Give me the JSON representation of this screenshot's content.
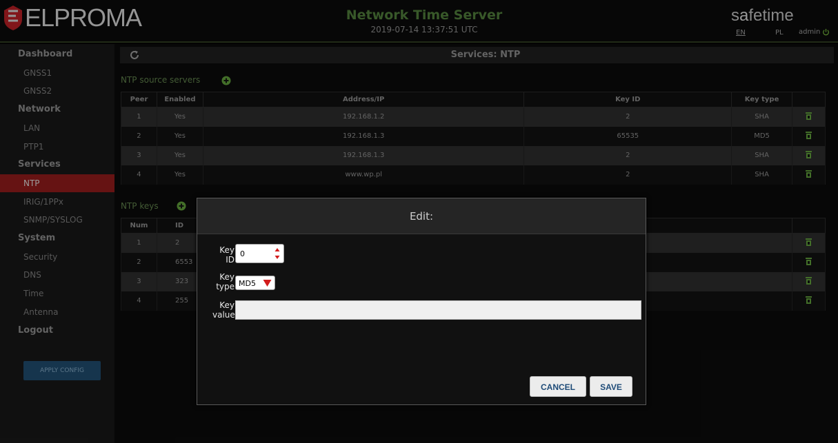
{
  "header": {
    "logo": "ELPROMA",
    "title": "Network Time Server",
    "datetime": "2019-07-14 13:37:51 UTC",
    "brand_pre": "s",
    "brand_a": "a",
    "brand_post": "fetime",
    "lang_en": "EN",
    "lang_pl": "PL",
    "user": "admin"
  },
  "sidebar": {
    "items": [
      {
        "label": "Dashboard",
        "type": "head"
      },
      {
        "label": "GNSS1",
        "type": "sub"
      },
      {
        "label": "GNSS2",
        "type": "sub"
      },
      {
        "label": "Network",
        "type": "head"
      },
      {
        "label": "LAN",
        "type": "sub"
      },
      {
        "label": "PTP1",
        "type": "sub"
      },
      {
        "label": "Services",
        "type": "head"
      },
      {
        "label": "NTP",
        "type": "sub",
        "active": true
      },
      {
        "label": "IRIG/1PPx",
        "type": "sub"
      },
      {
        "label": "SNMP/SYSLOG",
        "type": "sub"
      },
      {
        "label": "System",
        "type": "head"
      },
      {
        "label": "Security",
        "type": "sub"
      },
      {
        "label": "DNS",
        "type": "sub"
      },
      {
        "label": "Time",
        "type": "sub"
      },
      {
        "label": "Antenna",
        "type": "sub"
      },
      {
        "label": "Logout",
        "type": "head"
      }
    ],
    "apply_label": "APPLY CONFIG"
  },
  "main": {
    "section_title": "Services: NTP",
    "servers": {
      "caption": "NTP source servers",
      "columns": [
        "Peer",
        "Enabled",
        "Address/IP",
        "Key ID",
        "Key type"
      ],
      "rows": [
        [
          "1",
          "Yes",
          "192.168.1.2",
          "2",
          "SHA"
        ],
        [
          "2",
          "Yes",
          "192.168.1.3",
          "65535",
          "MD5"
        ],
        [
          "3",
          "Yes",
          "192.168.1.3",
          "2",
          "SHA"
        ],
        [
          "4",
          "Yes",
          "www.wp.pl",
          "2",
          "SHA"
        ]
      ]
    },
    "keys": {
      "caption": "NTP keys",
      "columns": [
        "Num",
        "ID"
      ],
      "rows": [
        [
          "1",
          "2"
        ],
        [
          "2",
          "6553"
        ],
        [
          "3",
          "323"
        ],
        [
          "4",
          "255"
        ]
      ]
    }
  },
  "modal": {
    "title": "Edit:",
    "key_id_label": "Key ID",
    "key_id_value": "0",
    "key_type_label": "Key type",
    "key_type_value": "MD5",
    "key_value_label": "Key value",
    "key_value": "",
    "cancel_label": "CANCEL",
    "save_label": "SAVE"
  },
  "colors": {
    "accent_green": "#4e7a3a",
    "active_red": "#8e1b1b",
    "apply_blue": "#1f4a6b",
    "button_text_blue": "#1e4b78"
  }
}
